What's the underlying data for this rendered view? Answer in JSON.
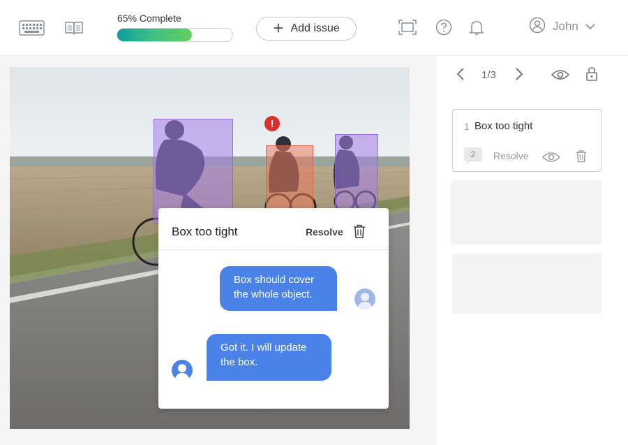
{
  "toolbar": {
    "progress_label": "65% Complete",
    "progress_value": 0.65,
    "add_issue_label": "Add issue",
    "user_name": "John"
  },
  "annotations": [
    {
      "label_color": "#a57de8",
      "kind": "bounding-box"
    },
    {
      "label_color": "#ea7a5c",
      "kind": "bounding-box"
    },
    {
      "label_color": "#a57de8",
      "kind": "bounding-box"
    }
  ],
  "comment_popup": {
    "title": "Box too tight",
    "resolve_label": "Resolve",
    "messages": [
      {
        "text_line1": "Box should cover",
        "text_line2": "the whole object.",
        "author": "reviewer"
      },
      {
        "text_line1": "Got it. I will update",
        "text_line2": "the box.",
        "author": "annotator"
      }
    ]
  },
  "right_panel": {
    "pager": "1/3",
    "issues": [
      {
        "number": "1",
        "title": "Box too tight",
        "comment_count": "2",
        "resolve_label": "Resolve"
      }
    ]
  },
  "colors": {
    "bubble_blue": "#4b82e8",
    "alert_red": "#d8322f",
    "progress_start": "#0c9c9a",
    "progress_end": "#62d060"
  }
}
